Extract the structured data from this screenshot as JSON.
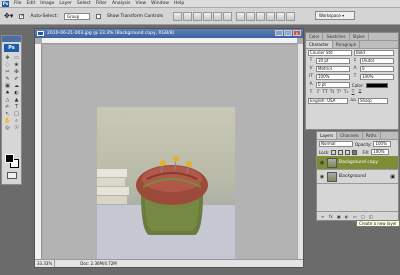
{
  "menubar": {
    "logo": "Ps",
    "items": [
      "File",
      "Edit",
      "Image",
      "Layer",
      "Select",
      "Filter",
      "Analysis",
      "View",
      "Window",
      "Help"
    ]
  },
  "options_bar": {
    "auto_select_label": "Auto-Select:",
    "auto_select_value": "Group",
    "show_transform_label": "Show Transform Controls",
    "workspace_label": "Workspace ▾"
  },
  "toolbox": {
    "logo": "Ps",
    "tools": [
      "✥",
      "▭",
      "◌",
      "❀",
      "✂",
      "✠",
      "✎",
      "✐",
      "▣",
      "☁",
      "♠",
      "◐",
      "△",
      "▲",
      "✍",
      "T",
      "↖",
      "□",
      "✋",
      "⌕",
      "◎",
      "☉"
    ]
  },
  "document": {
    "title": "2010-06-21-003.jpg @ 33.3% (Background copy, RGB/8)",
    "status": "Doc: 2.36M/4.72M",
    "controls": [
      "_",
      "□",
      "×"
    ]
  },
  "character_panel": {
    "tabs": [
      "Color",
      "Swatches",
      "Styles"
    ],
    "tabs2": [
      "Character",
      "Paragraph"
    ],
    "font_family": "Courier Std",
    "font_style": "Bold",
    "font_size": "30 pt",
    "leading": "(Auto)",
    "kerning": "Metrics",
    "tracking": "0",
    "vscale": "100%",
    "hscale": "100%",
    "baseline": "0 pt",
    "color_label": "Color:",
    "language": "English: USA",
    "antialias": "Sharp"
  },
  "layers_panel": {
    "tabs": [
      "Layers",
      "Channels",
      "Paths"
    ],
    "blend": "Normal",
    "opacity_label": "Opacity:",
    "opacity": "100%",
    "lock_label": "Lock:",
    "fill_label": "Fill:",
    "fill": "100%",
    "layers": [
      {
        "name": "Background copy",
        "selected": true
      },
      {
        "name": "Background",
        "selected": false
      }
    ],
    "tooltip": "Create a new layer"
  },
  "colors": {
    "selection": "#7d8e37",
    "accent": "#3e62a0"
  }
}
